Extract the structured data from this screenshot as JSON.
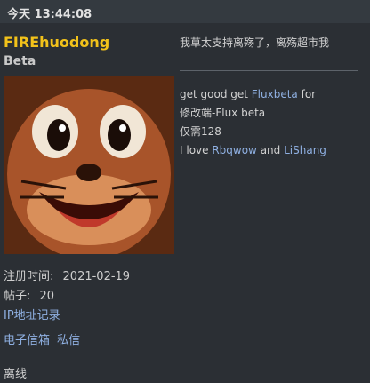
{
  "header": {
    "timestamp": "今天 13:44:08"
  },
  "user": {
    "name": "FIREhuodong",
    "title": "Beta",
    "registered_label": "注册时间:",
    "registered_value": "2021-02-19",
    "posts_label": "帖子:",
    "posts_value": "20",
    "ip_link": "IP地址记录",
    "email_link": "电子信箱",
    "pm_link": "私信",
    "status": "离线"
  },
  "post": {
    "text": "我草太支持离殇了，离殇超市我"
  },
  "signature": {
    "line1_prefix": "get good get ",
    "line1_link": "Fluxbeta",
    "line1_suffix": " for",
    "line2": "修改端-Flux beta",
    "line3": "仅需128",
    "line4_prefix": "I love ",
    "line4_link1": "Rbqwow",
    "line4_mid": " and ",
    "line4_link2": "LiShang"
  },
  "colors": {
    "background": "#2b2f34",
    "username": "#f2c21a",
    "link": "#8fb0e2"
  }
}
